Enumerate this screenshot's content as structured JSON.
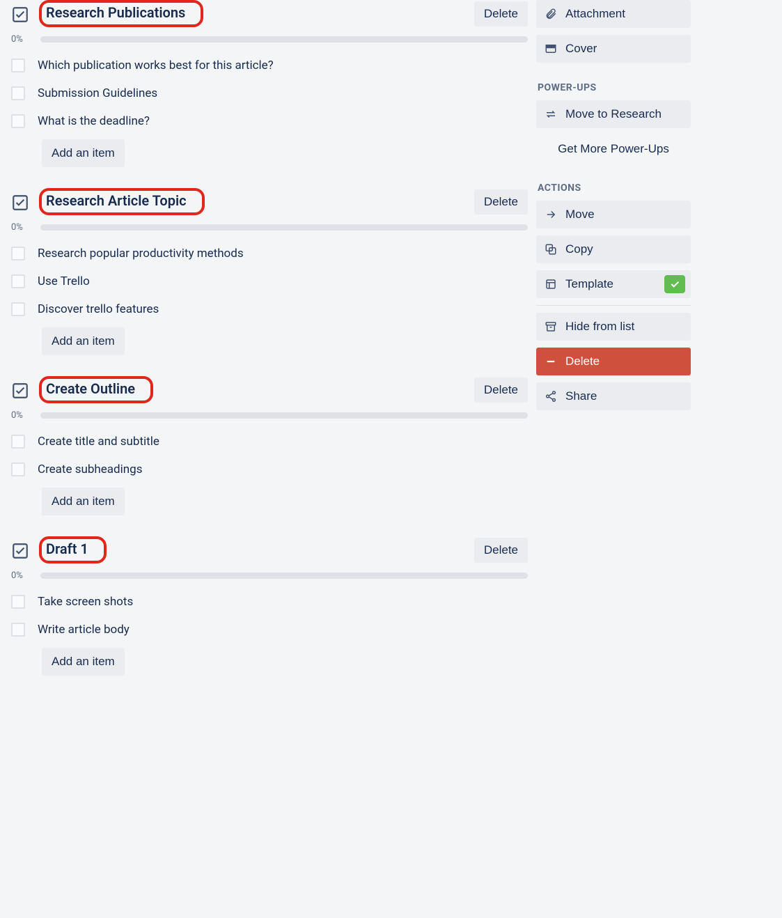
{
  "checklists": [
    {
      "title": "Research Publications",
      "delete_label": "Delete",
      "progress_label": "0%",
      "items": [
        "Which publication works best for this article?",
        "Submission Guidelines",
        "What is the deadline?"
      ],
      "add_label": "Add an item"
    },
    {
      "title": "Research Article Topic",
      "delete_label": "Delete",
      "progress_label": "0%",
      "items": [
        "Research popular productivity methods",
        "Use Trello",
        "Discover trello features"
      ],
      "add_label": "Add an item"
    },
    {
      "title": "Create Outline",
      "delete_label": "Delete",
      "progress_label": "0%",
      "items": [
        "Create title and subtitle",
        "Create subheadings"
      ],
      "add_label": "Add an item"
    },
    {
      "title": "Draft 1",
      "delete_label": "Delete",
      "progress_label": "0%",
      "items": [
        "Take screen shots",
        "Write article body"
      ],
      "add_label": "Add an item"
    }
  ],
  "sidebar": {
    "attachment_label": "Attachment",
    "cover_label": "Cover",
    "powerups_heading": "POWER-UPS",
    "powerups": {
      "move_to_research_label": "Move to Research",
      "get_more_label": "Get More Power-Ups"
    },
    "actions_heading": "ACTIONS",
    "actions": {
      "move_label": "Move",
      "copy_label": "Copy",
      "template_label": "Template",
      "hide_label": "Hide from list",
      "delete_label": "Delete",
      "share_label": "Share"
    }
  }
}
